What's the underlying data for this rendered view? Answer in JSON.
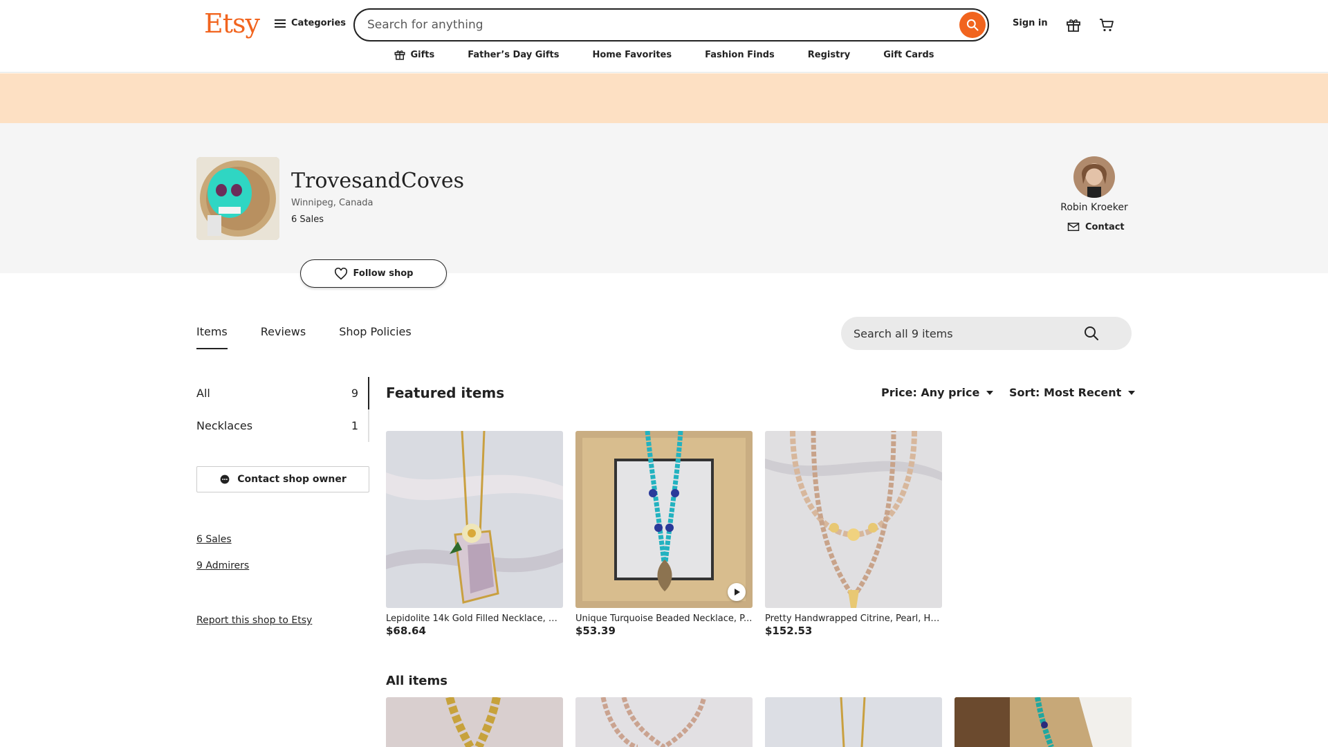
{
  "header": {
    "logo": "Etsy",
    "categories_label": "Categories",
    "search_placeholder": "Search for anything",
    "signin_label": "Sign in",
    "nav": [
      {
        "label": "Gifts"
      },
      {
        "label": "Father’s Day Gifts"
      },
      {
        "label": "Home Favorites"
      },
      {
        "label": "Fashion Finds"
      },
      {
        "label": "Registry"
      },
      {
        "label": "Gift Cards"
      }
    ]
  },
  "colors": {
    "brand": "#f1641e",
    "banner": "#fde0c3"
  },
  "shop": {
    "name": "TrovesandCoves",
    "location": "Winnipeg, Canada",
    "sales": "6 Sales",
    "follow_label": "Follow shop",
    "owner_name": "Robin Kroeker",
    "contact_label": "Contact"
  },
  "tabs": [
    {
      "label": "Items",
      "active": true
    },
    {
      "label": "Reviews",
      "active": false
    },
    {
      "label": "Shop Policies",
      "active": false
    }
  ],
  "shop_search_placeholder": "Search all 9 items",
  "sidebar": {
    "sections": [
      {
        "label": "All",
        "count": "9"
      },
      {
        "label": "Necklaces",
        "count": "1"
      }
    ],
    "contact_owner_label": "Contact shop owner",
    "sales_link": "6 Sales",
    "admirers_link": "9 Admirers",
    "report_link": "Report this shop to Etsy"
  },
  "featured": {
    "title": "Featured items",
    "price_filter": "Price: Any price",
    "sort_filter": "Sort: Most Recent",
    "items": [
      {
        "title": "Lepidolite 14k Gold Filled Necklace, C...",
        "price": "$68.64"
      },
      {
        "title": "Unique Turquoise Beaded Necklace, P...",
        "price": "$53.39"
      },
      {
        "title": "Pretty Handwrapped Citrine, Pearl, He...",
        "price": "$152.53"
      }
    ]
  },
  "all_items": {
    "title": "All items"
  }
}
